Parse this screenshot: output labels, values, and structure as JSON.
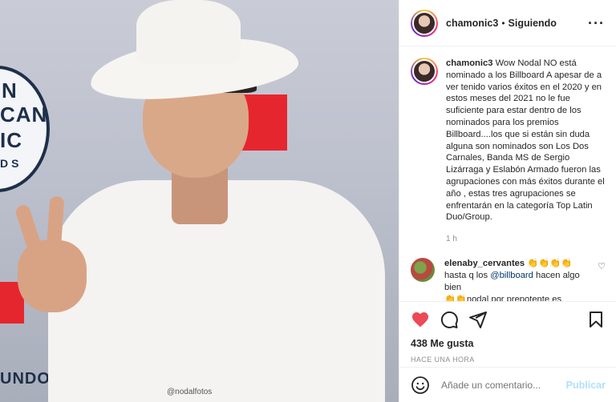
{
  "post": {
    "username": "chamonic3",
    "follow_separator": "•",
    "follow_status": "Siguiendo",
    "more_icon": "more-horizontal-icon",
    "photo_watermark": "@nodalfotos"
  },
  "caption": {
    "username": "chamonic3",
    "text": "Wow Nodal NO está nominado a los Billboard A apesar de a ver tenido varios éxitos en el 2020 y en estos meses del 2021 no le fue suficiente para estar dentro de los nominados para los premios Billboard....los que si están sin duda alguna son nominados son Los Dos Carnales, Banda MS de Sergio Lizárraga y Eslabón Armado fueron las agrupaciones con más éxitos durante el año , estas tres agrupaciones se enfrentarán en la categoría Top Latin Duo/Group.",
    "time": "1 h"
  },
  "comment": {
    "username": "elenaby_cervantes",
    "emoji": "👏👏👏👏",
    "text_before": "hasta q los",
    "mention": "@billboard",
    "text_after": "hacen algo bien",
    "line3": "👏👏nodal por prepotente es"
  },
  "actions": {
    "likes": "438 Me gusta",
    "posted": "HACE UNA HORA"
  },
  "add_comment": {
    "placeholder": "Añade un comentario...",
    "publish": "Publicar"
  },
  "colors": {
    "heart": "#ed4956",
    "publish_disabled": "#b2dffc",
    "mention": "#00376b"
  }
}
